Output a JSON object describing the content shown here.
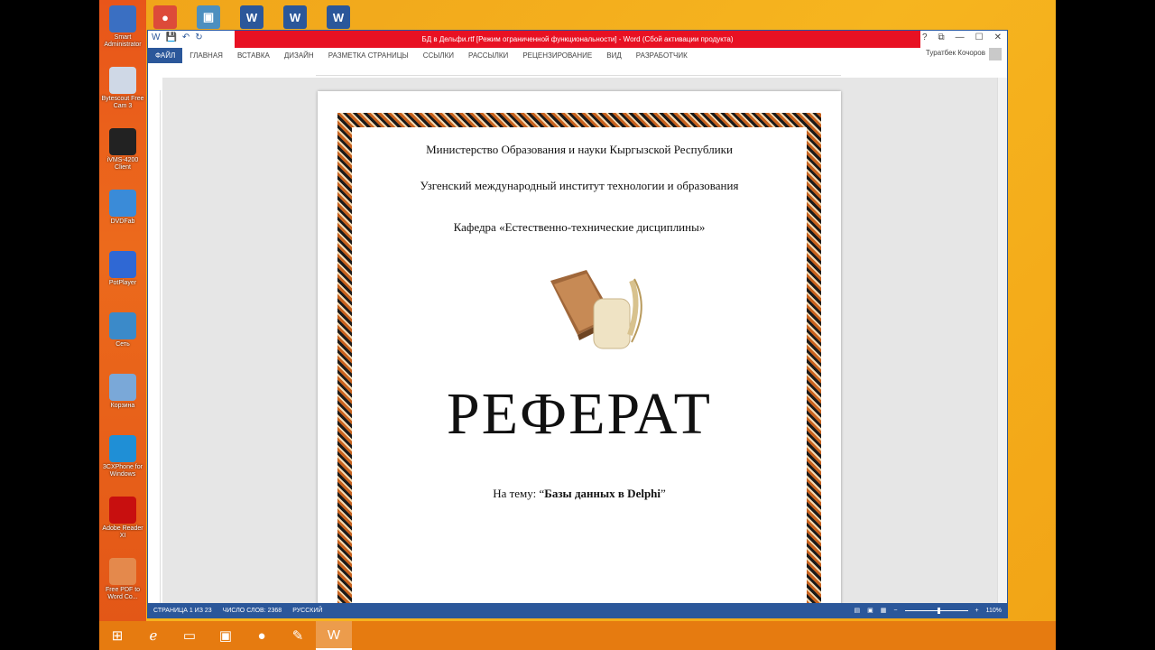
{
  "desktop": {
    "icons": [
      {
        "label": "Smart Administrator",
        "icon": "monitor-icon",
        "color": "#3a6fc2"
      },
      {
        "label": "Bytescout Free Cam 3",
        "icon": "camera-icon",
        "color": "#cfd8e6"
      },
      {
        "label": "iVMS-4200 Client",
        "icon": "cctv-icon",
        "color": "#222222"
      },
      {
        "label": "DVDFab",
        "icon": "dvdfab-icon",
        "color": "#3a8bd8"
      },
      {
        "label": "PotPlayer",
        "icon": "player-icon",
        "color": "#2f68d4"
      },
      {
        "label": "Сеть",
        "icon": "network-icon",
        "color": "#3b8ac9"
      },
      {
        "label": "Корзина",
        "icon": "recycle-bin-icon",
        "color": "#7aa8d8"
      },
      {
        "label": "3CXPhone for Windows",
        "icon": "phone-icon",
        "color": "#1f8fd6"
      },
      {
        "label": "Adobe Reader XI",
        "icon": "pdf-icon",
        "color": "#c80f0f"
      },
      {
        "label": "Free PDF to Word Co...",
        "icon": "pdf-convert-icon",
        "color": "#e4894c"
      }
    ],
    "top_icons": [
      {
        "name": "chrome-icon",
        "color": "#dd4b39",
        "glyph": "●"
      },
      {
        "name": "app-icon",
        "color": "#4d8fbf",
        "glyph": "▣"
      },
      {
        "name": "word-doc-icon",
        "color": "#2b579a",
        "glyph": "W"
      },
      {
        "name": "word-doc-icon-2",
        "color": "#2b579a",
        "glyph": "W"
      },
      {
        "name": "word-doc-icon-3",
        "color": "#2b579a",
        "glyph": "W"
      }
    ]
  },
  "window": {
    "title": "БД в Дельфи.rtf [Режим ограниченной функциональности] - Word (Сбой активации продукта)",
    "user": "Туратбек Кочоров",
    "controls": [
      "?",
      "⧉",
      "—",
      "☐",
      "✕"
    ]
  },
  "ribbon": {
    "tabs": [
      "ФАЙЛ",
      "ГЛАВНАЯ",
      "ВСТАВКА",
      "ДИЗАЙН",
      "РАЗМЕТКА СТРАНИЦЫ",
      "ССЫЛКИ",
      "РАССЫЛКИ",
      "РЕЦЕНЗИРОВАНИЕ",
      "ВИД",
      "РАЗРАБОТЧИК"
    ]
  },
  "document": {
    "ministry": "Министерство Образования и науки Кыргызской Республики",
    "institute": "Узгенский международный институт технологии и образования",
    "department": "Кафедра «Естественно-технические дисциплины»",
    "heading": "РЕФЕРАТ",
    "topic_prefix": "На тему: “",
    "topic_title": "Базы данных в Delphi",
    "topic_suffix": "”"
  },
  "status": {
    "page": "СТРАНИЦА 1 ИЗ 23",
    "words": "ЧИСЛО СЛОВ: 2368",
    "language": "РУССКИЙ",
    "zoom": "110%",
    "zoom_value": 110
  },
  "colors": {
    "word_blue": "#2b579a",
    "title_red": "#e81123",
    "desktop_orange": "#f2a416",
    "taskbar": "#e67b10"
  }
}
